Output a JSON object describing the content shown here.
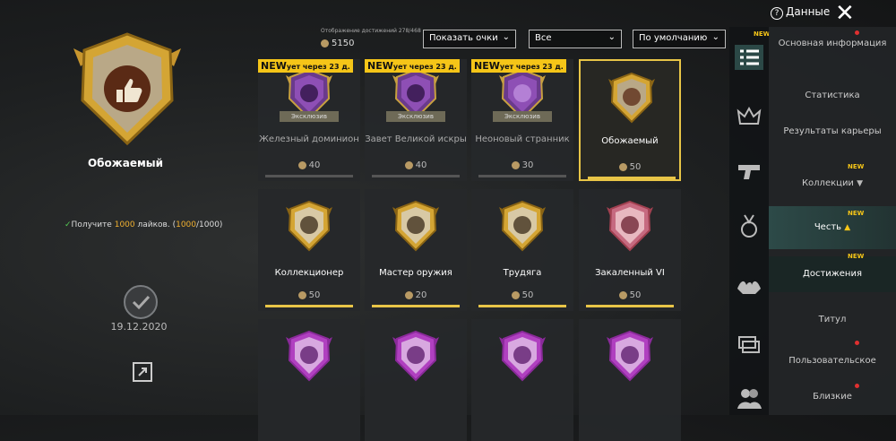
{
  "left": {
    "title": "Обожаемый",
    "requirement": {
      "prefix": "Получите ",
      "count": "1000",
      "mid": " лайков. (",
      "progress": "1000",
      "total": "/1000)"
    },
    "date": "19.12.2020"
  },
  "header": {
    "progress_label": "Отображение достижений 278/468",
    "coins": "5150",
    "dropdowns": [
      "Показать очки",
      "Все",
      "По умолчанию"
    ],
    "help_label": "Данные"
  },
  "cards": [
    {
      "new": "NEW",
      "timer": "ует через 23 д.",
      "tag": "Эксклюзив",
      "name": "Железный доминион",
      "points": "40"
    },
    {
      "new": "NEW",
      "timer": "ует через 23 д.",
      "tag": "Эксклюзив",
      "name": "Завет Великой искры",
      "points": "40"
    },
    {
      "new": "NEW",
      "timer": "ует через 23 д.",
      "tag": "Эксклюзив",
      "name": "Неоновый странник",
      "points": "30"
    },
    {
      "name": "Обожаемый",
      "points": "50"
    },
    {
      "name": "Коллекционер",
      "points": "50"
    },
    {
      "name": "Мастер оружия",
      "points": "20"
    },
    {
      "name": "Трудяга",
      "points": "50"
    },
    {
      "name": "Закаленный VI",
      "points": "50"
    },
    {
      "name": "",
      "points": ""
    },
    {
      "name": "",
      "points": ""
    },
    {
      "name": "",
      "points": ""
    },
    {
      "name": "",
      "points": ""
    }
  ],
  "menu": {
    "new_label": "NEW",
    "items": [
      "Основная информация",
      "Статистика",
      "Результаты карьеры",
      "Коллекции",
      "Честь",
      "Достижения",
      "Титул",
      "Пользовательское",
      "Близкие"
    ]
  },
  "colors": {
    "gold": "#e8c547",
    "accent_teal": "#2d4a48",
    "new_yellow": "#f5c518"
  }
}
